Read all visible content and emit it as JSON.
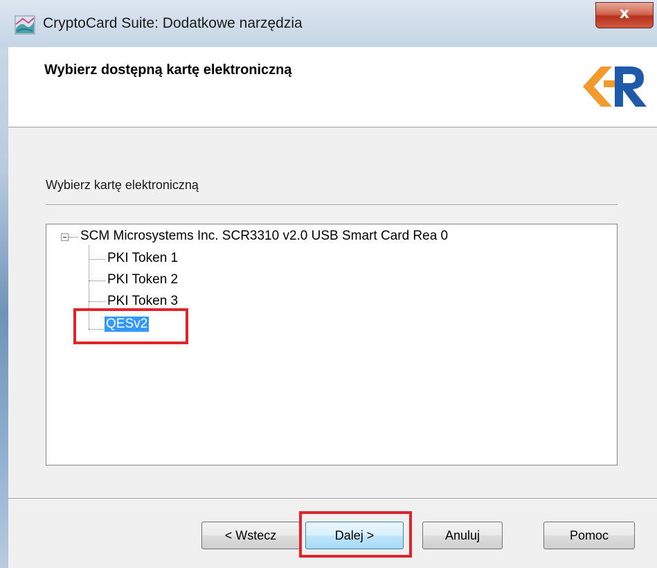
{
  "window": {
    "title": "CryptoCard Suite: Dodatkowe narzędzia",
    "close_label": "x"
  },
  "header": {
    "title": "Wybierz dostępną kartę elektroniczną",
    "logo_icon": "kr-logo-icon"
  },
  "content": {
    "section_label": "Wybierz kartę elektroniczną",
    "tree": {
      "root": {
        "label": "SCM Microsystems Inc. SCR3310 v2.0 USB Smart Card Rea 0",
        "expanded": true,
        "children": [
          {
            "label": "PKI Token 1"
          },
          {
            "label": "PKI Token 2"
          },
          {
            "label": "PKI Token 3"
          },
          {
            "label": "QESv2",
            "selected": true
          }
        ]
      }
    }
  },
  "buttons": {
    "back": "< Wstecz",
    "next": "Dalej >",
    "cancel": "Anuluj",
    "help": "Pomoc"
  },
  "colors": {
    "selection": "#3399ff",
    "highlight_box": "#e0242b",
    "logo_orange": "#f29a2e",
    "logo_blue": "#1e5aa8"
  }
}
